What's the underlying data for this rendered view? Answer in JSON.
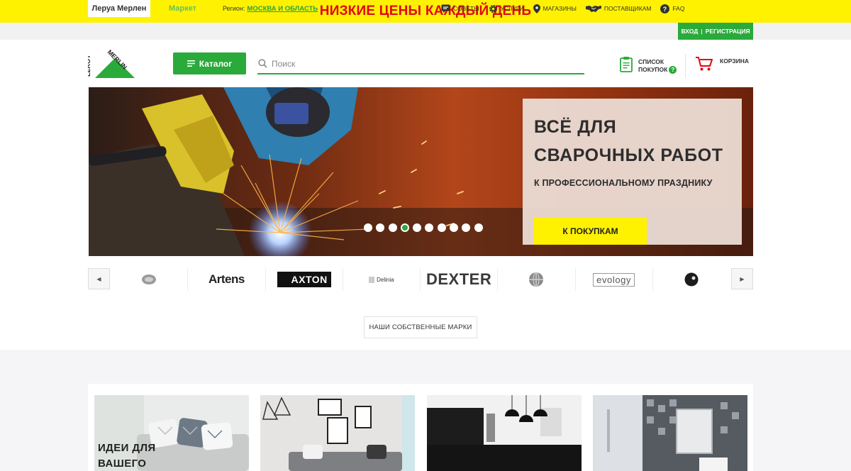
{
  "promo": {
    "text": "НИЗКИЕ ЦЕНЫ КАЖДЫЙ ДЕНЬ"
  },
  "topbar": {
    "tabs": [
      {
        "label": "Леруа Мерлен"
      },
      {
        "label": "Маркет"
      }
    ],
    "region_label": "Регион:",
    "region_value": "МОСКВА И ОБЛАСТЬ",
    "nav": [
      {
        "label": "СОВЕТЫ",
        "icon": "chat-icon"
      },
      {
        "label": "УСЛУГИ",
        "icon": "gear-icon"
      },
      {
        "label": "МАГАЗИНЫ",
        "icon": "map-pin-icon"
      },
      {
        "label": "ПОСТАВЩИКАМ",
        "icon": "handshake-icon"
      },
      {
        "label": "FAQ",
        "icon": "question-icon"
      }
    ],
    "login": "ВХОД",
    "register": "РЕГИСТРАЦИЯ"
  },
  "header": {
    "logo_text": "LEROY MERLIN",
    "catalog_label": "Каталог",
    "search_placeholder": "Поиск",
    "shoplist_line1": "СПИСОК",
    "shoplist_line2": "ПОКУПОК",
    "shoplist_badge": "?",
    "cart_label": "КОРЗИНА"
  },
  "hero": {
    "title_line1": "ВСЁ ДЛЯ",
    "title_line2": "СВАРОЧНЫХ РАБОТ",
    "subtitle": "К ПРОФЕССИОНАЛЬНОМУ ПРАЗДНИКУ",
    "cta": "К ПОКУПКАМ",
    "slide_count": 10,
    "active_slide": 4
  },
  "brands": {
    "items": [
      "",
      "Artens",
      "AXTON",
      "Delinia",
      "DEXTER",
      "",
      "evology",
      ""
    ]
  },
  "own_brands_button": "НАШИ СОБСТВЕННЫЕ МАРКИ",
  "ideas": {
    "first_card_title_line1": "ИДЕИ ДЛЯ",
    "first_card_title_line2": "ВАШЕГО"
  },
  "colors": {
    "brand_green": "#2aaa3a",
    "promo_yellow": "#fff200",
    "promo_red": "#e30613"
  }
}
